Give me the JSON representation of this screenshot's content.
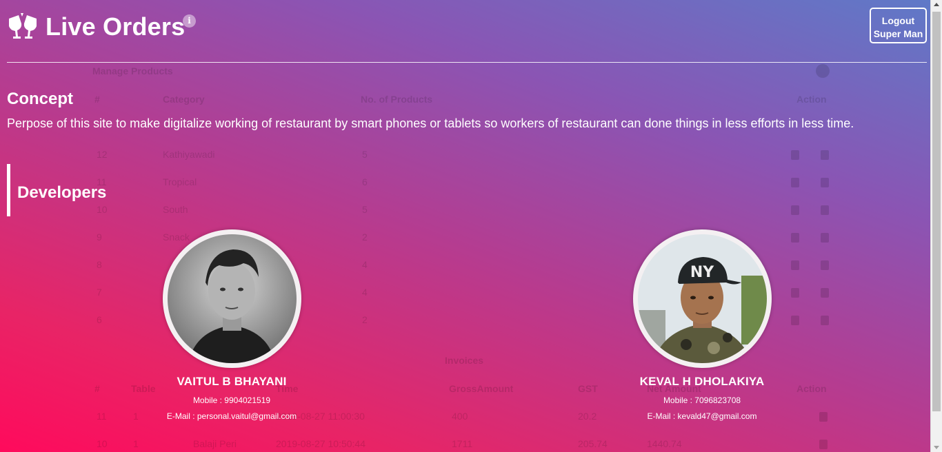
{
  "header": {
    "title": "Live Orders",
    "info_icon": "info-icon",
    "logout_label_line1": "Logout",
    "logout_label_line2": "Super Man"
  },
  "concept": {
    "heading": "Concept",
    "text": "Perpose of this site to make digitalize working of restaurant by smart phones or tablets so workers of restaurant can done things in less efforts in less time."
  },
  "developers": {
    "heading": "Developers",
    "people": [
      {
        "name": "VAITUL B BHAYANI",
        "mobile_label": "Mobile : ",
        "mobile": "9904021519",
        "email_label": "E-Mail : ",
        "email": "personal.vaitul@gmail.com"
      },
      {
        "name": "KEVAL H DHOLAKIYA",
        "mobile_label": "Mobile : ",
        "mobile": "7096823708",
        "email_label": "E-Mail : ",
        "email": "kevald47@gmail.com"
      }
    ]
  },
  "background": {
    "manage_products_title": "Manage Products",
    "products_headers": [
      "#",
      "Category",
      "No. of Products",
      "Action"
    ],
    "products_rows": [
      {
        "id": "12",
        "category": "Kathiyawadi",
        "count": "5"
      },
      {
        "id": "11",
        "category": "Tropical",
        "count": "6"
      },
      {
        "id": "10",
        "category": "South",
        "count": "5"
      },
      {
        "id": "9",
        "category": "Snack",
        "count": "2"
      },
      {
        "id": "8",
        "category": "",
        "count": "4"
      },
      {
        "id": "7",
        "category": "",
        "count": "4"
      },
      {
        "id": "6",
        "category": "",
        "count": "2"
      }
    ],
    "invoices_title": "Invoices",
    "invoices_headers": [
      "#",
      "Table",
      "",
      "Time",
      "GrossAmount",
      "GST",
      "Net Amount",
      "Action"
    ],
    "invoices_rows": [
      {
        "id": "11",
        "table": "1",
        "name": "",
        "time": "2019-08-27 11:00:30",
        "gross": "400",
        "gst": "20.2",
        "net": ""
      },
      {
        "id": "10",
        "table": "1",
        "name": "Balaji Peri",
        "time": "2019-08-27 10:50:44",
        "gross": "1711",
        "gst": "205.74",
        "net": "1440.74"
      }
    ]
  },
  "colors": {
    "gradient_start": "#ff0a5c",
    "gradient_mid": "#b33d92",
    "gradient_end": "#5e7ac8",
    "text": "#ffffff"
  }
}
